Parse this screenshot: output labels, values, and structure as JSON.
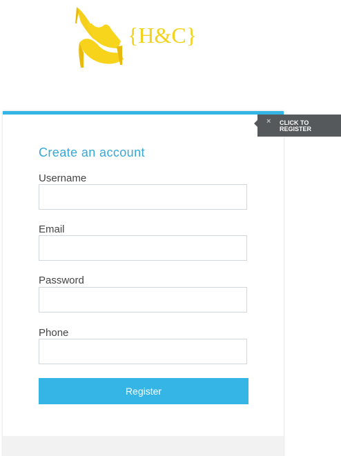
{
  "logo": {
    "text": "{H&C}",
    "color": "#f2d21a"
  },
  "side_tab": {
    "close_icon": "×",
    "label": "CLICK TO REGISTER"
  },
  "form": {
    "title": "Create an account",
    "fields": [
      {
        "label": "Username",
        "value": "",
        "placeholder": ""
      },
      {
        "label": "Email",
        "value": "",
        "placeholder": ""
      },
      {
        "label": "Password",
        "value": "",
        "placeholder": ""
      },
      {
        "label": "Phone",
        "value": "",
        "placeholder": ""
      }
    ],
    "submit_label": "Register"
  },
  "colors": {
    "accent": "#35b5e5",
    "title": "#35a7d8",
    "tab_background": "#55595c"
  }
}
